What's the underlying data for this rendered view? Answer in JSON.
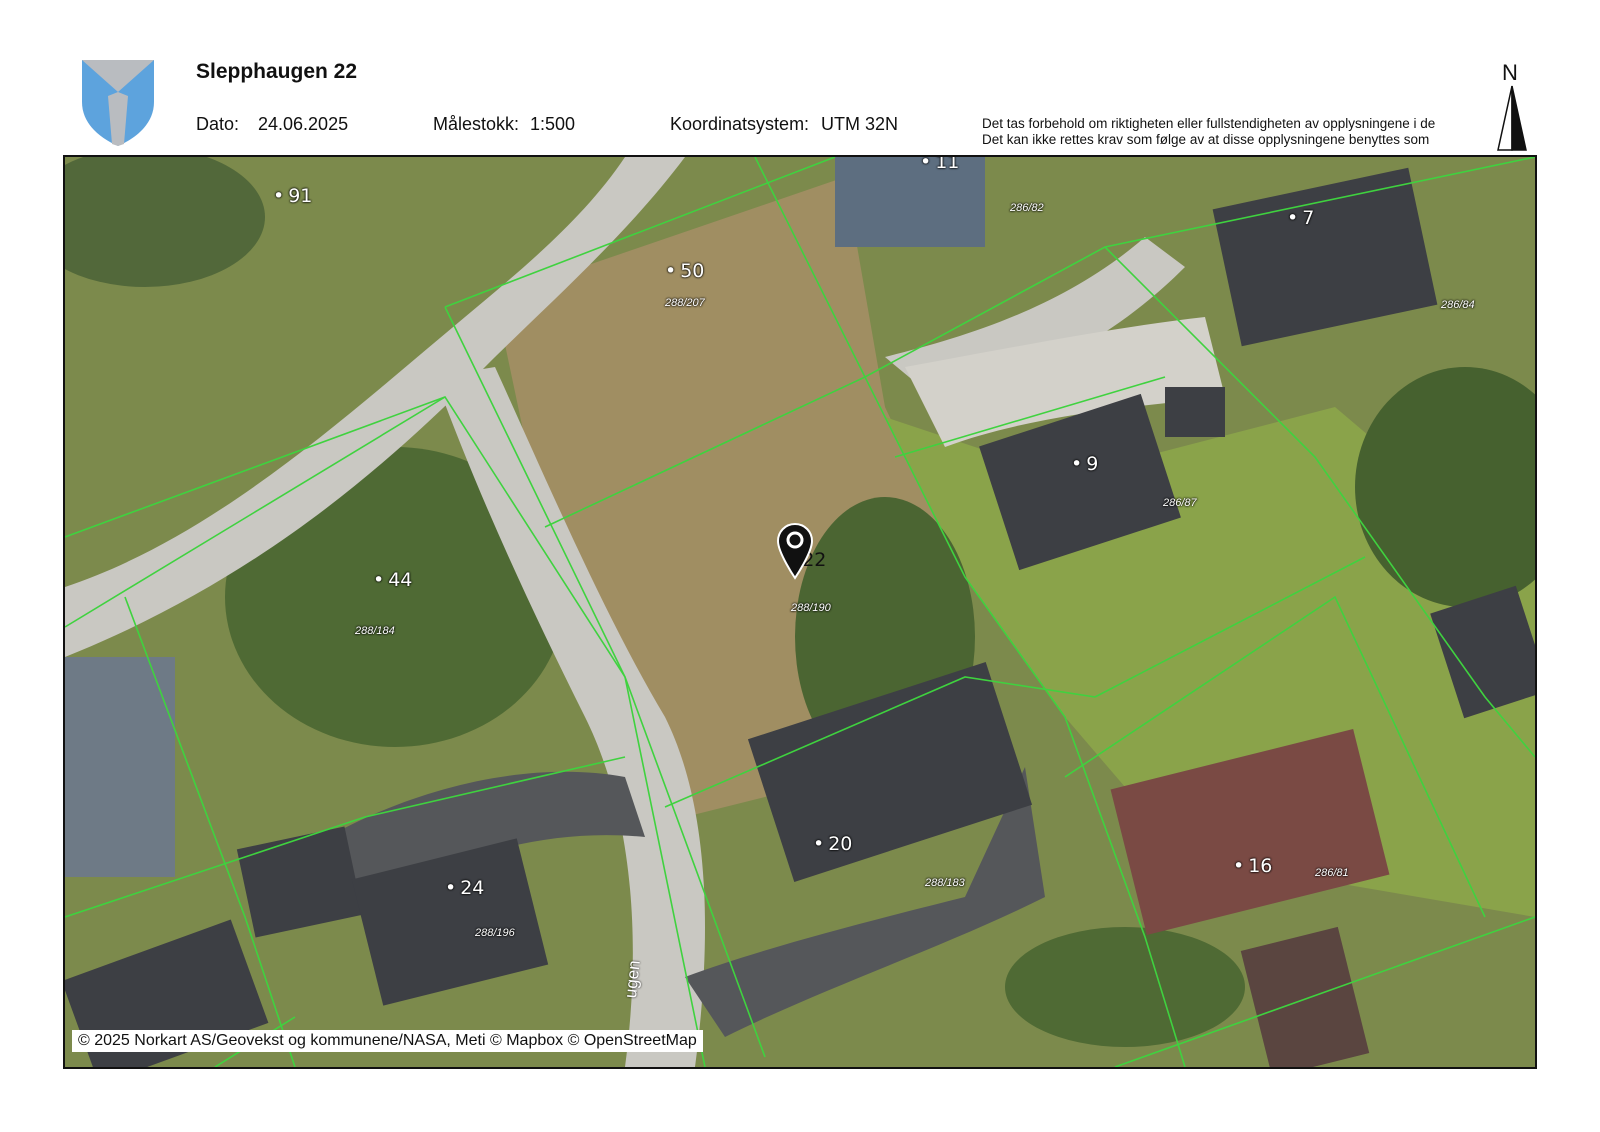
{
  "header": {
    "title": "Slepphaugen 22",
    "date_label": "Dato:",
    "date_value": "24.06.2025",
    "scale_label": "Målestokk:",
    "scale_value": "1:500",
    "crs_label": "Koordinatsystem:",
    "crs_value": "UTM 32N",
    "disclaimer_line1": "Det tas forbehold om riktigheten eller fullstendigheten av opplysningene i de",
    "disclaimer_line2": "Det kan ikke rettes krav som følge av at disse opplysningene benyttes som"
  },
  "north_arrow": {
    "letter": "N"
  },
  "map": {
    "copyright": "© 2025 Norkart AS/Geovekst og kommunene/NASA, Meti © Mapbox © OpenStreetMap",
    "addresses": [
      {
        "label": "91"
      },
      {
        "label": "11"
      },
      {
        "label": "7"
      },
      {
        "label": "50"
      },
      {
        "label": "9"
      },
      {
        "label": "22"
      },
      {
        "label": "44"
      },
      {
        "label": "20"
      },
      {
        "label": "16"
      },
      {
        "label": "24"
      }
    ],
    "parcels": [
      {
        "label": "286/82"
      },
      {
        "label": "286/84"
      },
      {
        "label": "288/207"
      },
      {
        "label": "286/87"
      },
      {
        "label": "288/190"
      },
      {
        "label": "288/184"
      },
      {
        "label": "288/183"
      },
      {
        "label": "286/81"
      },
      {
        "label": "288/196"
      }
    ],
    "road_label": "Slepphaugen",
    "road_label_visible": "ugen"
  },
  "colors": {
    "vegetation": "#7c8a4c",
    "grass": "#8aa34a",
    "road": "#c9c8c2",
    "asphalt": "#55575a",
    "roof_dark": "#3d3f44",
    "roof_brown": "#7a4a44",
    "parcel_line": "#3fd23f",
    "crest_blue": "#5da3dd",
    "crest_gray": "#b9bcc0"
  }
}
